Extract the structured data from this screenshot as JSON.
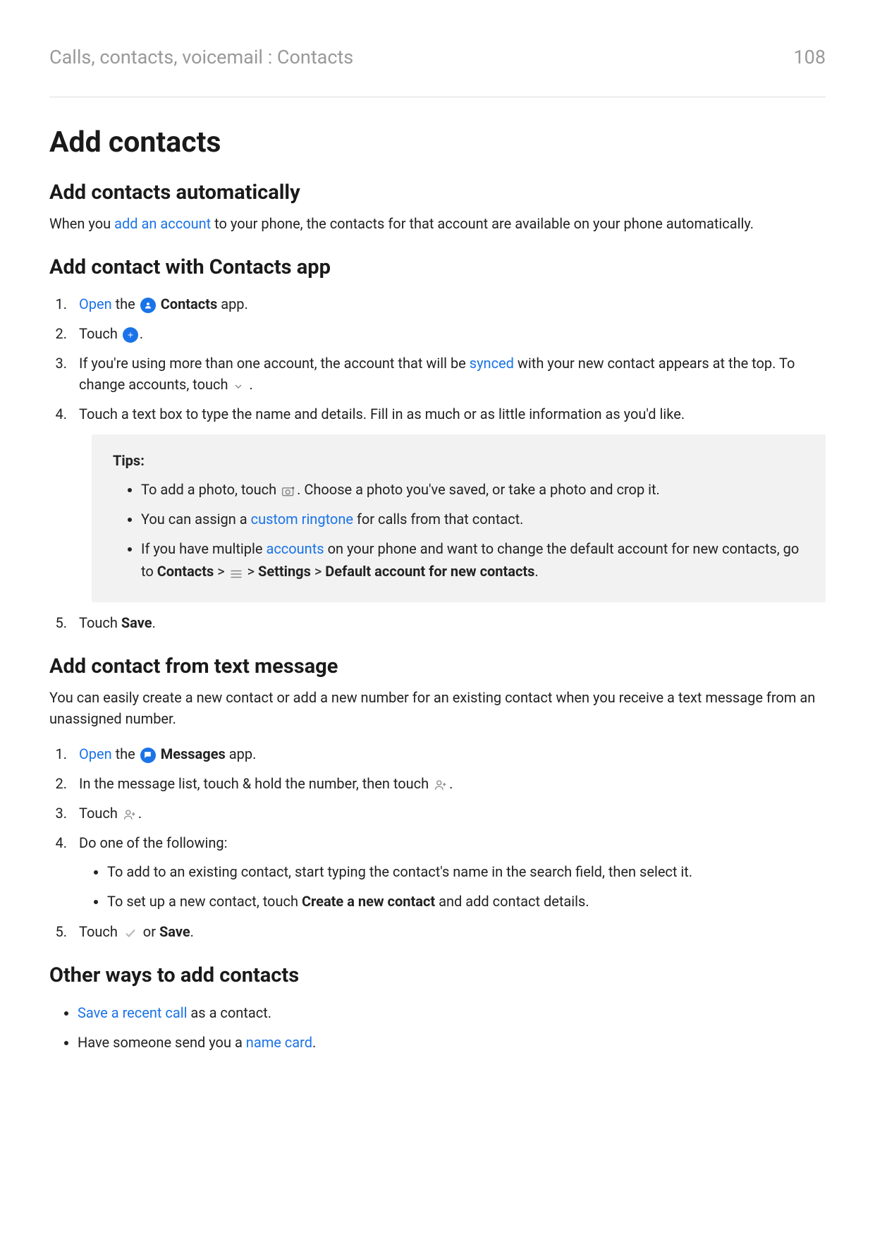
{
  "header": {
    "breadcrumb": "Calls, contacts, voicemail : Contacts",
    "page_number": "108"
  },
  "title": "Add contacts",
  "sec_auto": {
    "heading": "Add contacts automatically",
    "p1_a": "When you ",
    "p1_link": "add an account",
    "p1_b": " to your phone, the contacts for that account are available on your phone automatically."
  },
  "sec_app": {
    "heading": "Add contact with Contacts app",
    "s1": {
      "open": "Open",
      "the": " the ",
      "app_name": "Contacts",
      "after": " app."
    },
    "s2": {
      "touch": "Touch ",
      "dot": "."
    },
    "s3": {
      "a": "If you're using more than one account, the account that will be ",
      "link": "synced",
      "b": " with your new contact appears at the top. To change accounts, touch ",
      "c": " ."
    },
    "s4": "Touch a text box to type the name and details. Fill in as much or as little information as you'd like.",
    "tips": {
      "title": "Tips:",
      "t1_a": "To add a photo, touch ",
      "t1_b": ". Choose a photo you've saved, or take a photo and crop it.",
      "t2_a": "You can assign a ",
      "t2_link": "custom ringtone",
      "t2_b": " for calls from that contact.",
      "t3_a": "If you have multiple ",
      "t3_link": "accounts",
      "t3_b": " on your phone and want to change the default account for new contacts, go to ",
      "t3_c": "Contacts",
      "t3_d": " > ",
      "t3_e": " > ",
      "t3_f": "Settings",
      "t3_g": " > ",
      "t3_h": "Default account for new contacts",
      "t3_i": "."
    },
    "s5_a": "Touch ",
    "s5_b": "Save",
    "s5_c": "."
  },
  "sec_msg": {
    "heading": "Add contact from text message",
    "intro": "You can easily create a new contact or add a new number for an existing contact when you receive a text message from an unassigned number.",
    "s1": {
      "open": "Open",
      "the": " the ",
      "app_name": "Messages",
      "after": " app."
    },
    "s2_a": "In the message list, touch & hold the number, then touch ",
    "s2_b": ".",
    "s3_a": "Touch ",
    "s3_b": ".",
    "s4": "Do one of the following:",
    "s4_b1": "To add to an existing contact, start typing the contact's name in the search field, then select it.",
    "s4_b2_a": "To set up a new contact, touch ",
    "s4_b2_b": "Create a new contact",
    "s4_b2_c": " and add contact details.",
    "s5_a": "Touch ",
    "s5_b": " or ",
    "s5_c": "Save",
    "s5_d": "."
  },
  "sec_other": {
    "heading": "Other ways to add contacts",
    "b1_link": "Save a recent call",
    "b1_after": " as a contact.",
    "b2_before": "Have someone send you a ",
    "b2_link": "name card",
    "b2_after": "."
  }
}
